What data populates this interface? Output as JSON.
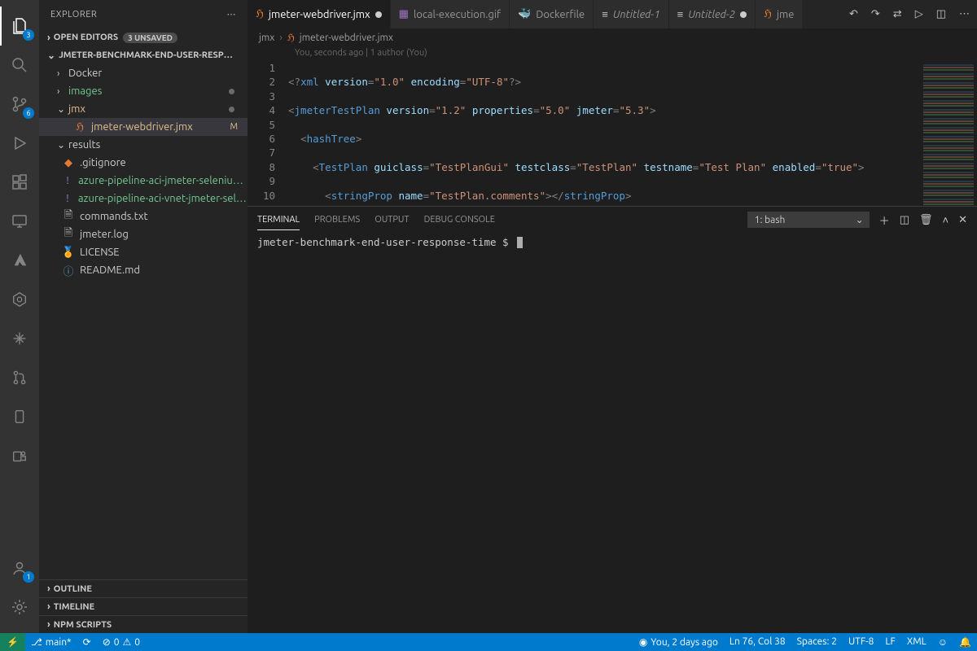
{
  "sidebar": {
    "title": "EXPLORER",
    "openEditors": {
      "label": "OPEN EDITORS",
      "unsaved": "3 UNSAVED"
    },
    "projectName": "JMETER-BENCHMARK-END-USER-RESPONSE-...",
    "folders": {
      "docker": "Docker",
      "images": "images",
      "jmx": "jmx",
      "results": "results"
    },
    "files": {
      "jmeterWebdriver": "jmeter-webdriver.jmx",
      "gitignore": ".gitignore",
      "azure1": "azure-pipeline-aci-jmeter-selenium-hea...",
      "azure2": "azure-pipeline-aci-vnet-jmeter-selenium...",
      "commands": "commands.txt",
      "jmeterLog": "jmeter.log",
      "license": "LICENSE",
      "readme": "README.md"
    },
    "fileStatus": {
      "jmeterWebdriver": "M"
    },
    "bottom": {
      "outline": "OUTLINE",
      "timeline": "TIMELINE",
      "npm": "NPM SCRIPTS"
    }
  },
  "activity": {
    "explorerBadge": "3",
    "scmBadge": "6",
    "accountsBadge": "1"
  },
  "tabs": {
    "t1": "jmeter-webdriver.jmx",
    "t2": "local-execution.gif",
    "t3": "Dockerfile",
    "t4": "Untitled-1",
    "t5": "Untitled-2",
    "t6": "jme"
  },
  "breadcrumbs": {
    "seg1": "jmx",
    "seg2": "jmeter-webdriver.jmx"
  },
  "blame": "You, seconds ago | 1 author (You)",
  "codeLines": [
    "1",
    "2",
    "3",
    "4",
    "5",
    "6",
    "7",
    "8",
    "9",
    "10",
    ""
  ],
  "panel": {
    "tabs": {
      "terminal": "TERMINAL",
      "problems": "PROBLEMS",
      "output": "OUTPUT",
      "debug": "DEBUG CONSOLE"
    },
    "termSelect": "1: bash",
    "prompt": "jmeter-benchmark-end-user-response-time $ "
  },
  "status": {
    "branch": "main*",
    "sync": "",
    "errors": "0",
    "warnings": "0",
    "blame": "You, 2 days ago",
    "lncol": "Ln 76, Col 38",
    "spaces": "Spaces: 2",
    "encoding": "UTF-8",
    "eol": "LF",
    "lang": "XML"
  }
}
